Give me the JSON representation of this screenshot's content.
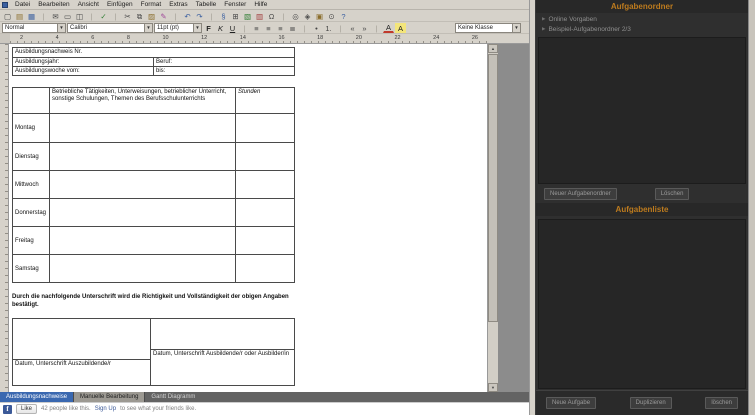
{
  "menu": {
    "items": [
      "Datei",
      "Bearbeiten",
      "Ansicht",
      "Einfügen",
      "Format",
      "Extras",
      "Tabelle",
      "Fenster",
      "Hilfe"
    ]
  },
  "toolbar1": {
    "icons": [
      {
        "name": "new-document-icon",
        "glyph": "▢",
        "color": "#4a4a4a"
      },
      {
        "name": "open-document-icon",
        "glyph": "▤",
        "color": "#8a6d2b"
      },
      {
        "name": "save-icon",
        "glyph": "▦",
        "color": "#3a5fa0"
      },
      {
        "name": "toolbar-separator",
        "glyph": "|",
        "color": "#a29e96",
        "inter": "false"
      },
      {
        "name": "email-icon",
        "glyph": "✉",
        "color": "#4a4a4a"
      },
      {
        "name": "print-icon",
        "glyph": "▭",
        "color": "#4a4a4a"
      },
      {
        "name": "print-preview-icon",
        "glyph": "◫",
        "color": "#4a4a4a"
      },
      {
        "name": "toolbar-separator",
        "glyph": "|",
        "color": "#a29e96",
        "inter": "false"
      },
      {
        "name": "spellcheck-icon",
        "glyph": "✓",
        "color": "#2e7d32"
      },
      {
        "name": "toolbar-separator",
        "glyph": "|",
        "color": "#a29e96",
        "inter": "false"
      },
      {
        "name": "cut-icon",
        "glyph": "✂",
        "color": "#4a4a4a"
      },
      {
        "name": "copy-icon",
        "glyph": "⧉",
        "color": "#4a4a4a"
      },
      {
        "name": "paste-icon",
        "glyph": "▨",
        "color": "#8a6d2b"
      },
      {
        "name": "format-paintbrush-icon",
        "glyph": "✎",
        "color": "#a04a9a"
      },
      {
        "name": "toolbar-separator",
        "glyph": "|",
        "color": "#a29e96",
        "inter": "false"
      },
      {
        "name": "undo-icon",
        "glyph": "↶",
        "color": "#3a5fa0"
      },
      {
        "name": "redo-icon",
        "glyph": "↷",
        "color": "#3a5fa0"
      },
      {
        "name": "toolbar-separator",
        "glyph": "|",
        "color": "#a29e96",
        "inter": "false"
      },
      {
        "name": "hyperlink-icon",
        "glyph": "§",
        "color": "#3a5fa0"
      },
      {
        "name": "table-icon",
        "glyph": "⊞",
        "color": "#4a4a4a"
      },
      {
        "name": "image-icon",
        "glyph": "▧",
        "color": "#2e7d32"
      },
      {
        "name": "chart-icon",
        "glyph": "▥",
        "color": "#a03a3a"
      },
      {
        "name": "special-character-icon",
        "glyph": "Ω",
        "color": "#4a4a4a"
      },
      {
        "name": "toolbar-separator",
        "glyph": "|",
        "color": "#a29e96",
        "inter": "false"
      },
      {
        "name": "find-replace-icon",
        "glyph": "◎",
        "color": "#4a4a4a"
      },
      {
        "name": "navigator-icon",
        "glyph": "◈",
        "color": "#4a4a4a"
      },
      {
        "name": "gallery-icon",
        "glyph": "▣",
        "color": "#8a6d2b"
      },
      {
        "name": "zoom-icon",
        "glyph": "⊙",
        "color": "#4a4a4a"
      },
      {
        "name": "help-icon",
        "glyph": "?",
        "color": "#3a5fa0"
      }
    ]
  },
  "toolbar2": {
    "style_value": "Normal",
    "font_value": "Calibri",
    "size_value": "11pt (pt)",
    "class_value": "Keine Klasse",
    "icons": [
      {
        "name": "bold-icon",
        "glyph": "F",
        "cls": "b",
        "color": "#222"
      },
      {
        "name": "italic-icon",
        "glyph": "K",
        "cls": "i",
        "color": "#222"
      },
      {
        "name": "underline-icon",
        "glyph": "U",
        "cls": "u",
        "color": "#222"
      },
      {
        "name": "toolbar-separator",
        "glyph": "|",
        "color": "#a29e96",
        "inter": "false"
      },
      {
        "name": "align-left-icon",
        "glyph": "≡",
        "color": "#444"
      },
      {
        "name": "align-center-icon",
        "glyph": "≡",
        "color": "#444"
      },
      {
        "name": "align-right-icon",
        "glyph": "≡",
        "color": "#444"
      },
      {
        "name": "align-justify-icon",
        "glyph": "≣",
        "color": "#444"
      },
      {
        "name": "toolbar-separator",
        "glyph": "|",
        "color": "#a29e96",
        "inter": "false"
      },
      {
        "name": "bullet-list-icon",
        "glyph": "•",
        "color": "#444"
      },
      {
        "name": "numbered-list-icon",
        "glyph": "1.",
        "color": "#444"
      },
      {
        "name": "toolbar-separator",
        "glyph": "|",
        "color": "#a29e96",
        "inter": "false"
      },
      {
        "name": "decrease-indent-icon",
        "glyph": "«",
        "color": "#444"
      },
      {
        "name": "increase-indent-icon",
        "glyph": "»",
        "color": "#444"
      },
      {
        "name": "toolbar-separator",
        "glyph": "|",
        "color": "#a29e96",
        "inter": "false"
      },
      {
        "name": "font-color-icon",
        "glyph": "A",
        "cls": "fontcolor",
        "color": "#222"
      },
      {
        "name": "highlight-color-icon",
        "glyph": "A",
        "cls": "hl",
        "color": "#222"
      }
    ]
  },
  "ruler": {
    "numbers": [
      "2",
      "4",
      "6",
      "8",
      "10",
      "12",
      "14",
      "16",
      "18",
      "20",
      "22",
      "24",
      "26"
    ]
  },
  "document": {
    "info": {
      "nr_label": "Ausbildungsnachweis Nr.",
      "year_label": "Ausbildungsjahr:",
      "beruf_label": "Beruf:",
      "week_from_label": "Ausbildungswoche vom:",
      "bis_label": "bis:"
    },
    "week": {
      "header": "Betriebliche Tätigkeiten, Unterweisungen, betrieblicher Unterricht, sonstige Schulungen, Themen des Berufsschulunterrichts",
      "hours_header": "Stunden",
      "days": [
        "Montag",
        "Dienstag",
        "Mittwoch",
        "Donnerstag",
        "Freitag",
        "Samstag"
      ]
    },
    "confirmation": "Durch die nachfolgende Unterschrift wird die Richtigkeit und Vollständigkeit der obigen Angaben bestätigt.",
    "signature": {
      "left_label": "Datum, Unterschrift Auszubildende/r",
      "right_label": "Datum, Unterschrift Ausbildende/r oder Ausbilder/in"
    }
  },
  "tabs": [
    {
      "label": "Ausbildungsnachweise"
    },
    {
      "label": "Manuelle Bearbeitung"
    },
    {
      "label": "Gantt Diagramm"
    }
  ],
  "facebook": {
    "like_label": "Like",
    "count_text": "42 people like this.",
    "signup_link": "Sign Up",
    "rest_text": "to see what your friends like."
  },
  "right_panel": {
    "folders_header": "Aufgabenordner",
    "folder_items": [
      {
        "label": "Online Vorgaben"
      },
      {
        "label": "Beispiel-Aufgabenordner 2/3"
      }
    ],
    "new_folder_button": "Neuer Aufgabenordner",
    "delete_folder_button": "Löschen",
    "tasks_header": "Aufgabenliste",
    "new_task_button": "Neue Aufgabe",
    "duplicate_button": "Duplizieren",
    "delete_task_button": "löschen"
  },
  "colors": {
    "accent_orange": "#bd7b1e",
    "active_tab_blue": "#3a68b0",
    "facebook_blue": "#3b5998"
  }
}
